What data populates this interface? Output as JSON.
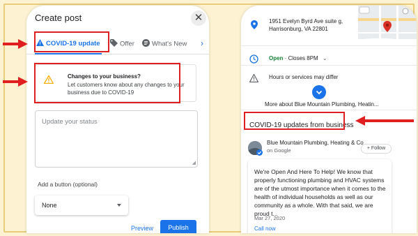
{
  "left_phone": {
    "header_title": "Create post",
    "close_glyph": "✕",
    "tabs": [
      {
        "label": "COVID-19 update",
        "icon": "warning-icon"
      },
      {
        "label": "Offer",
        "icon": "tag-icon"
      },
      {
        "label": "What's New",
        "icon": "post-icon"
      }
    ],
    "tabs_more_glyph": "›",
    "warning": {
      "title": "Changes to your business?",
      "text": "Let customers know about any changes to your business due to COVID-19"
    },
    "status_placeholder": "Update your status",
    "add_button_label": "Add a button (optional)",
    "button_select_value": "None",
    "preview_label": "Preview",
    "publish_label": "Publish"
  },
  "right_phone": {
    "address_line1": "1951 Evelyn Byrd Ave suite g,",
    "address_line2": "Harrisonburg, VA 22801",
    "open_status": "Open",
    "open_detail": " · Closes 8PM",
    "hours_notice": "Hours or services may differ",
    "more_about": "More about Blue Mountain Plumbing, Heatin...",
    "covid_heading": "COVID-19 updates from business",
    "business_name": "Blue Mountain Plumbing, Heating & Co",
    "business_source": "on Google",
    "follow_label": "Follow",
    "post_text": "We're Open And Here To Help! We know that properly functioning plumbing and HVAC systems are of the utmost importance when it comes to the health of individual households as well as our community as a whole. With that said, we are proud t...",
    "post_date": "Mar 27, 2020",
    "call_now": "Call now"
  },
  "colors": {
    "background": "#fdf3d3",
    "highlight_red": "#e02020",
    "google_blue": "#1a73e8",
    "open_green": "#188038"
  }
}
